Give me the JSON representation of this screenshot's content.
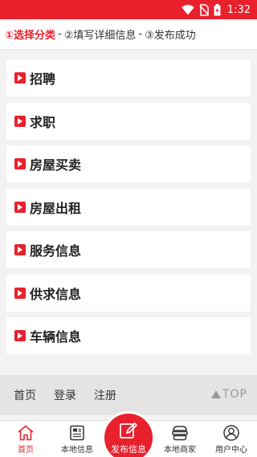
{
  "status_bar": {
    "time": "1:32",
    "icons": [
      "wifi-icon",
      "no-sim-icon",
      "battery-charging-icon"
    ]
  },
  "steps": {
    "step1": "①选择分类",
    "sep1": "-",
    "step2": "②填写详细信息",
    "sep2": "-",
    "step3": "③发布成功"
  },
  "categories": [
    {
      "label": "招聘"
    },
    {
      "label": "求职"
    },
    {
      "label": "房屋买卖"
    },
    {
      "label": "房屋出租"
    },
    {
      "label": "服务信息"
    },
    {
      "label": "供求信息"
    },
    {
      "label": "车辆信息"
    }
  ],
  "footer": {
    "home": "首页",
    "login": "登录",
    "register": "注册",
    "top": "TOP"
  },
  "tabbar": {
    "home": "首页",
    "local_info": "本地信息",
    "publish": "发布信息",
    "local_merchants": "本地商家",
    "user_center": "用户中心"
  },
  "colors": {
    "accent": "#e8212d",
    "background": "#f2f2f2",
    "footer": "#e4e4e4"
  }
}
